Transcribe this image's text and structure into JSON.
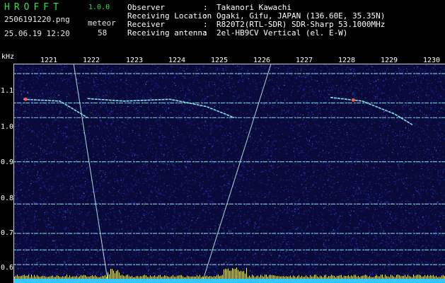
{
  "header": {
    "app_title": "HROFFT",
    "app_version": "1.0.0",
    "file_name": "2506191220.png",
    "timestamp": "25.06.19 12:20",
    "meteor_label": "meteor",
    "meteor_count": "58"
  },
  "station_info": [
    {
      "key": "Observer",
      "value": "Takanori Kawachi"
    },
    {
      "key": "Receiving Location",
      "value": "Ogaki, Gifu, JAPAN (136.60E, 35.35N)"
    },
    {
      "key": "Receiver",
      "value": "R820T2(RTL-SDR) SDR-Sharp 53.1000MHz"
    },
    {
      "key": "Receiving antenna",
      "value": "2el-HB9CV Vertical (el. E-W)"
    }
  ],
  "separator": ":",
  "axis": {
    "unit_label": "kHz",
    "x_ticks": [
      "1221",
      "1222",
      "1223",
      "1224",
      "1225",
      "1226",
      "1227",
      "1228",
      "1229",
      "1230"
    ],
    "y_ticks": [
      "1.1",
      "1.0",
      "0.9",
      "0.8",
      "0.7",
      "0.6"
    ],
    "x_range": [
      1220.6,
      1230.0
    ],
    "y_range": [
      0.57,
      1.165
    ]
  },
  "colors": {
    "background": "#000000",
    "title_green": "#2ee04a",
    "noise_blue": "#1a2fb0",
    "signal_cyan": "#8ff8ff",
    "peak_red": "#ff6040",
    "meter_yellow": "#ffff00",
    "meter_cyan": "#33c6ff"
  },
  "spectrogram": {
    "carriers_khz": [
      1.14,
      1.06,
      1.02,
      0.9,
      0.785,
      0.705,
      0.66,
      0.62
    ],
    "meteor_traces": [
      {
        "points": [
          [
            1220.8,
            1.07
          ],
          [
            1221.6,
            1.065
          ],
          [
            1222.2,
            1.02
          ]
        ],
        "peak": [
          1220.85,
          1.07
        ]
      },
      {
        "points": [
          [
            1222.2,
            1.072
          ],
          [
            1223.0,
            1.065
          ],
          [
            1224.0,
            1.07
          ],
          [
            1224.8,
            1.05
          ],
          [
            1225.4,
            1.02
          ]
        ]
      },
      {
        "points": [
          [
            1227.5,
            1.075
          ],
          [
            1228.2,
            1.065
          ],
          [
            1228.9,
            1.03
          ],
          [
            1229.3,
            1.0
          ]
        ],
        "peak": [
          1228.0,
          1.068
        ]
      }
    ],
    "aircraft_lines": [
      {
        "from": [
          1221.9,
          1.165
        ],
        "to": [
          1222.65,
          0.57
        ]
      },
      {
        "from": [
          1226.2,
          1.165
        ],
        "to": [
          1224.7,
          0.57
        ]
      }
    ]
  }
}
